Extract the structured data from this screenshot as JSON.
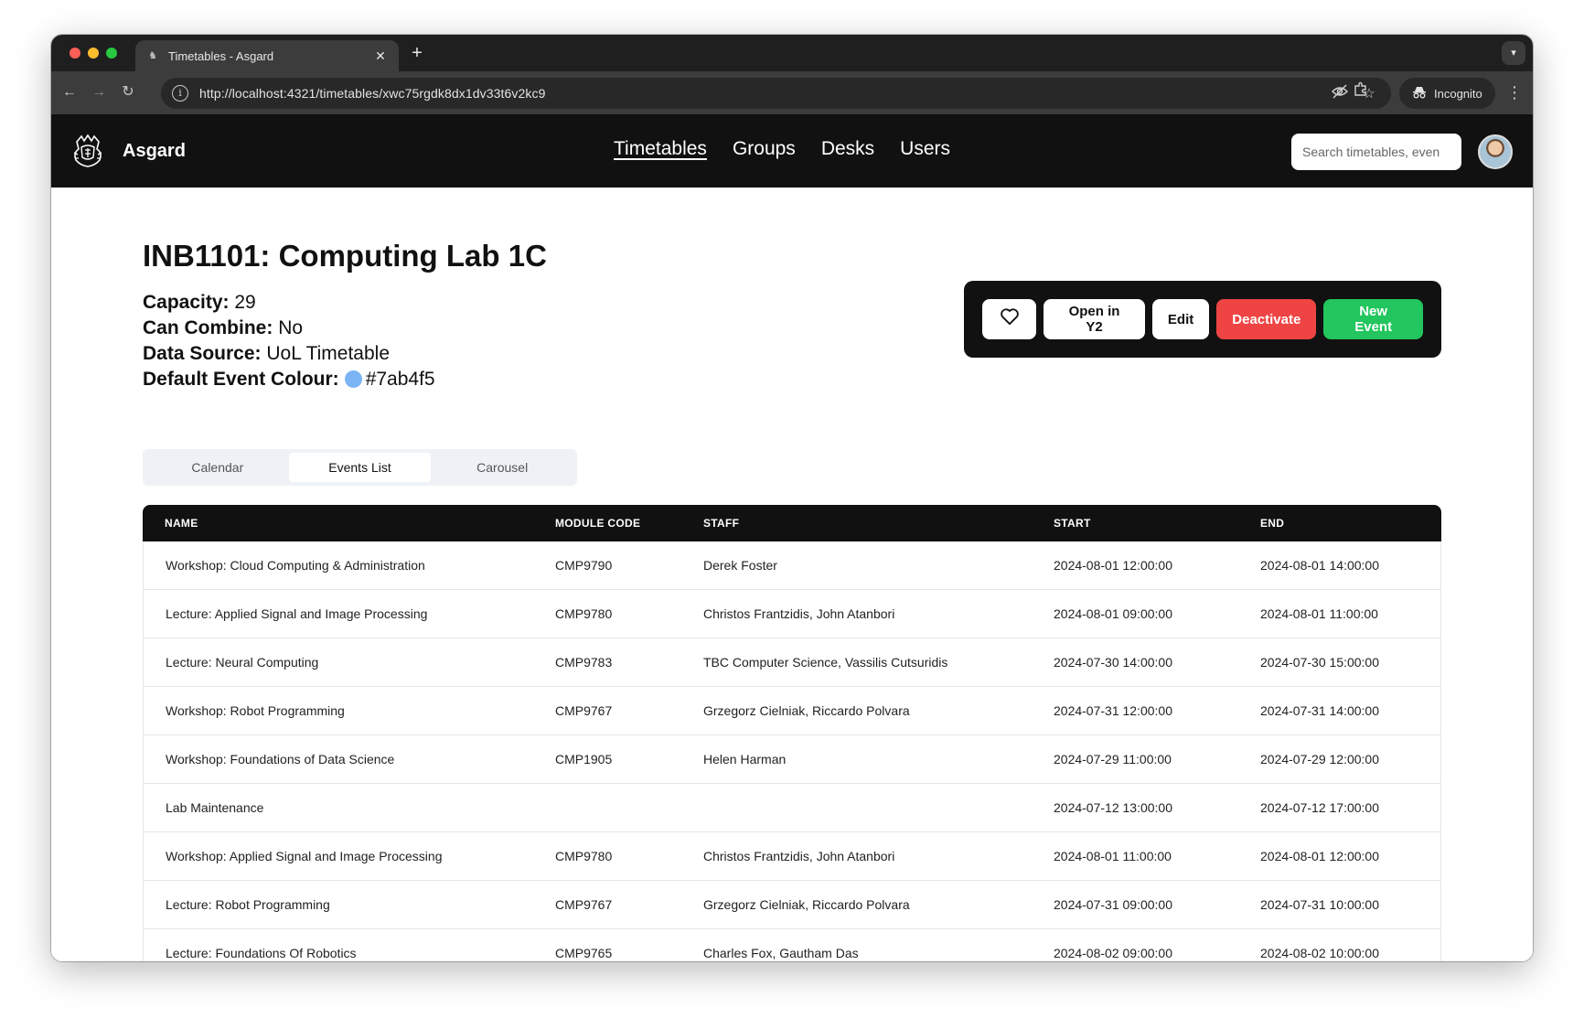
{
  "browser": {
    "tab_title": "Timetables - Asgard",
    "url": "http://localhost:4321/timetables/xwc75rgdk8dx1dv33t6v2kc9",
    "incognito_label": "Incognito"
  },
  "header": {
    "brand": "Asgard",
    "nav": [
      {
        "label": "Timetables",
        "active": true
      },
      {
        "label": "Groups",
        "active": false
      },
      {
        "label": "Desks",
        "active": false
      },
      {
        "label": "Users",
        "active": false
      }
    ],
    "search_placeholder": "Search timetables, even"
  },
  "room": {
    "code": "INB1101:",
    "name": "Computing Lab 1C",
    "capacity_label": "Capacity:",
    "capacity": "29",
    "can_combine_label": "Can Combine:",
    "can_combine": "No",
    "data_source_label": "Data Source:",
    "data_source": "UoL Timetable",
    "default_colour_label": "Default Event Colour:",
    "default_colour": "#7ab4f5"
  },
  "actions": {
    "open_in_y2": "Open in Y2",
    "edit": "Edit",
    "deactivate": "Deactivate",
    "new_event": "New Event"
  },
  "view_tabs": [
    {
      "label": "Calendar",
      "active": false
    },
    {
      "label": "Events List",
      "active": true
    },
    {
      "label": "Carousel",
      "active": false
    }
  ],
  "events_table": {
    "columns": [
      "NAME",
      "MODULE CODE",
      "STAFF",
      "START",
      "END"
    ],
    "rows": [
      [
        "Workshop: Cloud Computing & Administration",
        "CMP9790",
        "Derek Foster",
        "2024-08-01 12:00:00",
        "2024-08-01 14:00:00"
      ],
      [
        "Lecture: Applied Signal and Image Processing",
        "CMP9780",
        "Christos Frantzidis, John Atanbori",
        "2024-08-01 09:00:00",
        "2024-08-01 11:00:00"
      ],
      [
        "Lecture: Neural Computing",
        "CMP9783",
        "TBC Computer Science, Vassilis Cutsuridis",
        "2024-07-30 14:00:00",
        "2024-07-30 15:00:00"
      ],
      [
        "Workshop: Robot Programming",
        "CMP9767",
        "Grzegorz Cielniak, Riccardo Polvara",
        "2024-07-31 12:00:00",
        "2024-07-31 14:00:00"
      ],
      [
        "Workshop: Foundations of Data Science",
        "CMP1905",
        "Helen Harman",
        "2024-07-29 11:00:00",
        "2024-07-29 12:00:00"
      ],
      [
        "Lab Maintenance",
        "",
        "",
        "2024-07-12 13:00:00",
        "2024-07-12 17:00:00"
      ],
      [
        "Workshop: Applied Signal and Image Processing",
        "CMP9780",
        "Christos Frantzidis, John Atanbori",
        "2024-08-01 11:00:00",
        "2024-08-01 12:00:00"
      ],
      [
        "Lecture: Robot Programming",
        "CMP9767",
        "Grzegorz Cielniak, Riccardo Polvara",
        "2024-07-31 09:00:00",
        "2024-07-31 10:00:00"
      ],
      [
        "Lecture: Foundations Of Robotics",
        "CMP9765",
        "Charles Fox, Gautham Das",
        "2024-08-02 09:00:00",
        "2024-08-02 10:00:00"
      ]
    ]
  },
  "colors": {
    "header_bg": "#111111",
    "deactivate": "#ef4444",
    "new_event": "#22c55e"
  }
}
